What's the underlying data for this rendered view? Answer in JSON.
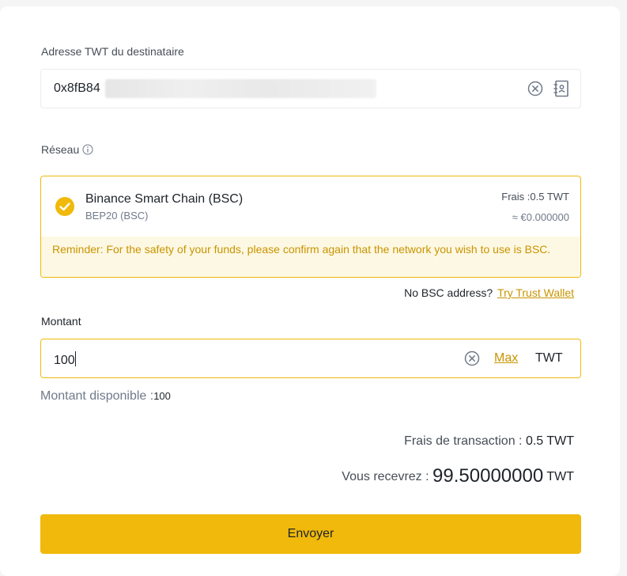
{
  "recipient": {
    "label": "Adresse TWT du destinataire",
    "address_visible": "0x8fB84"
  },
  "network": {
    "label": "Réseau",
    "selected_name": "Binance Smart Chain (BSC)",
    "selected_sub": "BEP20 (BSC)",
    "fee": "Frais :0.5 TWT",
    "fee_fiat": "≈ €0.000000",
    "reminder": "Reminder: For the safety of your funds, please confirm again that the network you wish to use is BSC."
  },
  "no_address": {
    "text": "No BSC address?",
    "link": "Try Trust Wallet"
  },
  "amount": {
    "label": "Montant",
    "value": "100",
    "max_label": "Max",
    "unit": "TWT",
    "available_label": "Montant disponible :",
    "available_value": "100"
  },
  "summary": {
    "fee_label": "Frais de transaction :",
    "fee_value": "0.5",
    "fee_unit": "TWT",
    "receive_label": "Vous recevrez :",
    "receive_value": "99.50000000",
    "receive_unit": "TWT"
  },
  "submit_label": "Envoyer",
  "colors": {
    "accent": "#f0b90b",
    "accent_text": "#c99400",
    "reminder_bg": "#fdf8e3"
  }
}
